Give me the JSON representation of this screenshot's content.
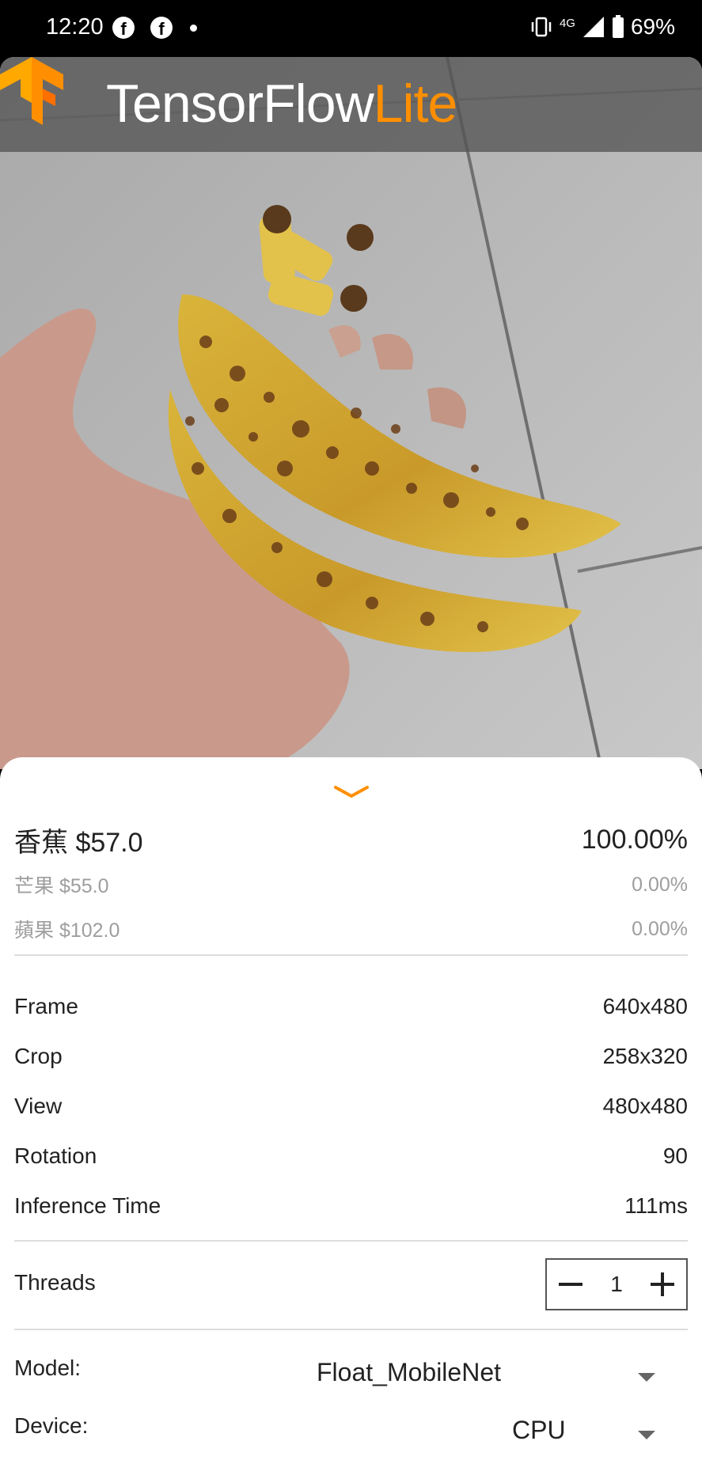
{
  "status_bar": {
    "time": "12:20",
    "network": "4G",
    "battery": "69%"
  },
  "app": {
    "brand_main": "TensorFlow",
    "brand_accent": "Lite",
    "accent_color": "#ff8f00"
  },
  "results": [
    {
      "label": "香蕉 $57.0",
      "score": "100.00%"
    },
    {
      "label": "芒果 $55.0",
      "score": "0.00%"
    },
    {
      "label": "蘋果 $102.0",
      "score": "0.00%"
    }
  ],
  "stats": [
    {
      "label": "Frame",
      "value": "640x480"
    },
    {
      "label": "Crop",
      "value": "258x320"
    },
    {
      "label": "View",
      "value": "480x480"
    },
    {
      "label": "Rotation",
      "value": "90"
    },
    {
      "label": "Inference Time",
      "value": "111ms"
    }
  ],
  "threads": {
    "label": "Threads",
    "value": "1"
  },
  "model": {
    "label": "Model:",
    "value": "Float_MobileNet"
  },
  "device": {
    "label": "Device:",
    "value": "CPU"
  }
}
